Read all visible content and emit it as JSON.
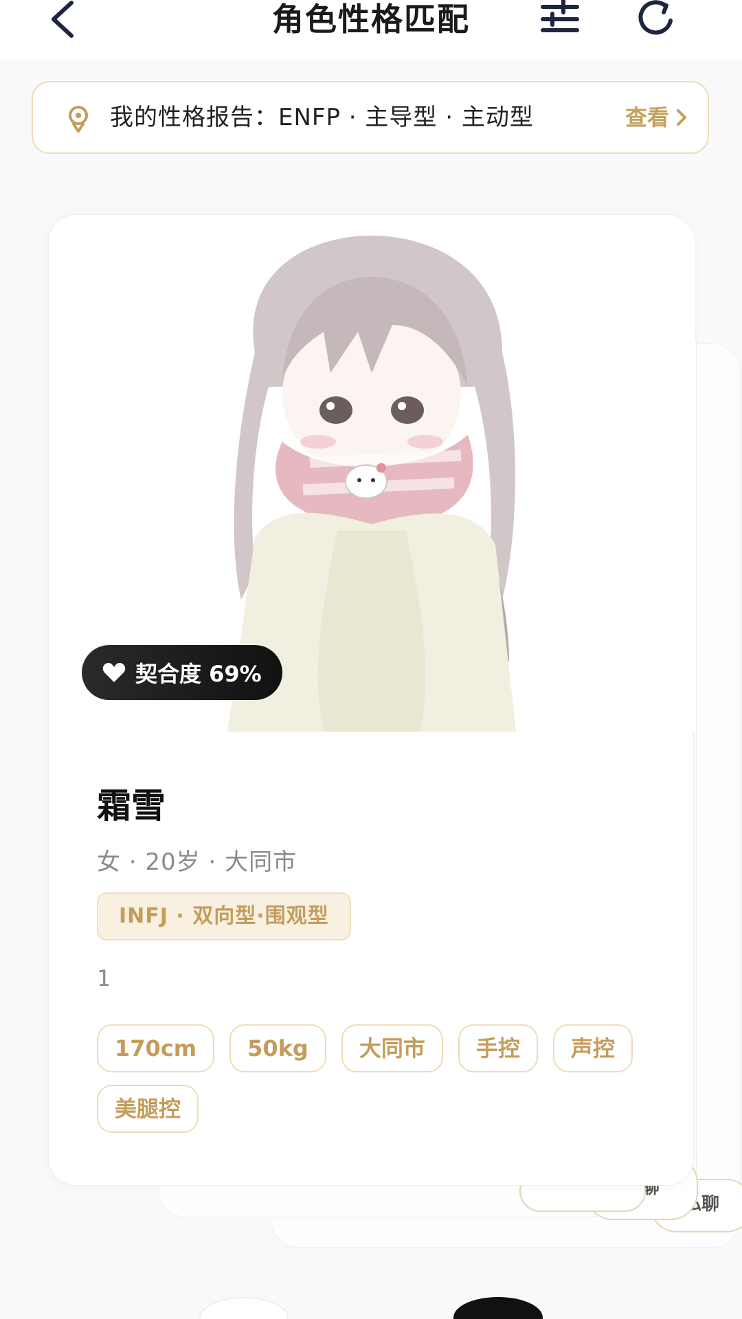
{
  "header": {
    "title": "角色性格匹配",
    "back_icon": "chevron-left-icon",
    "filter_icon": "sliders-icon",
    "refresh_icon": "refresh-icon"
  },
  "report": {
    "icon": "map-pin-icon",
    "text": "我的性格报告：ENFP · 主导型 · 主动型",
    "view_label": "查看"
  },
  "card": {
    "match_label": "契合度 69%",
    "name": "霜雪",
    "meta": "女 · 20岁 · 大同市",
    "mbti": "INFJ · 双向型·围观型",
    "bio": "1",
    "tags": [
      "170cm",
      "50kg",
      "大同市",
      "手控",
      "声控",
      "美腿控"
    ]
  },
  "back_cards": {
    "chat_label_1": "私聊",
    "chat_label_2": "私聊"
  },
  "colors": {
    "accent": "#c49d5b",
    "border": "#ecdcb8",
    "badge_bg": "#1a1a1a"
  }
}
